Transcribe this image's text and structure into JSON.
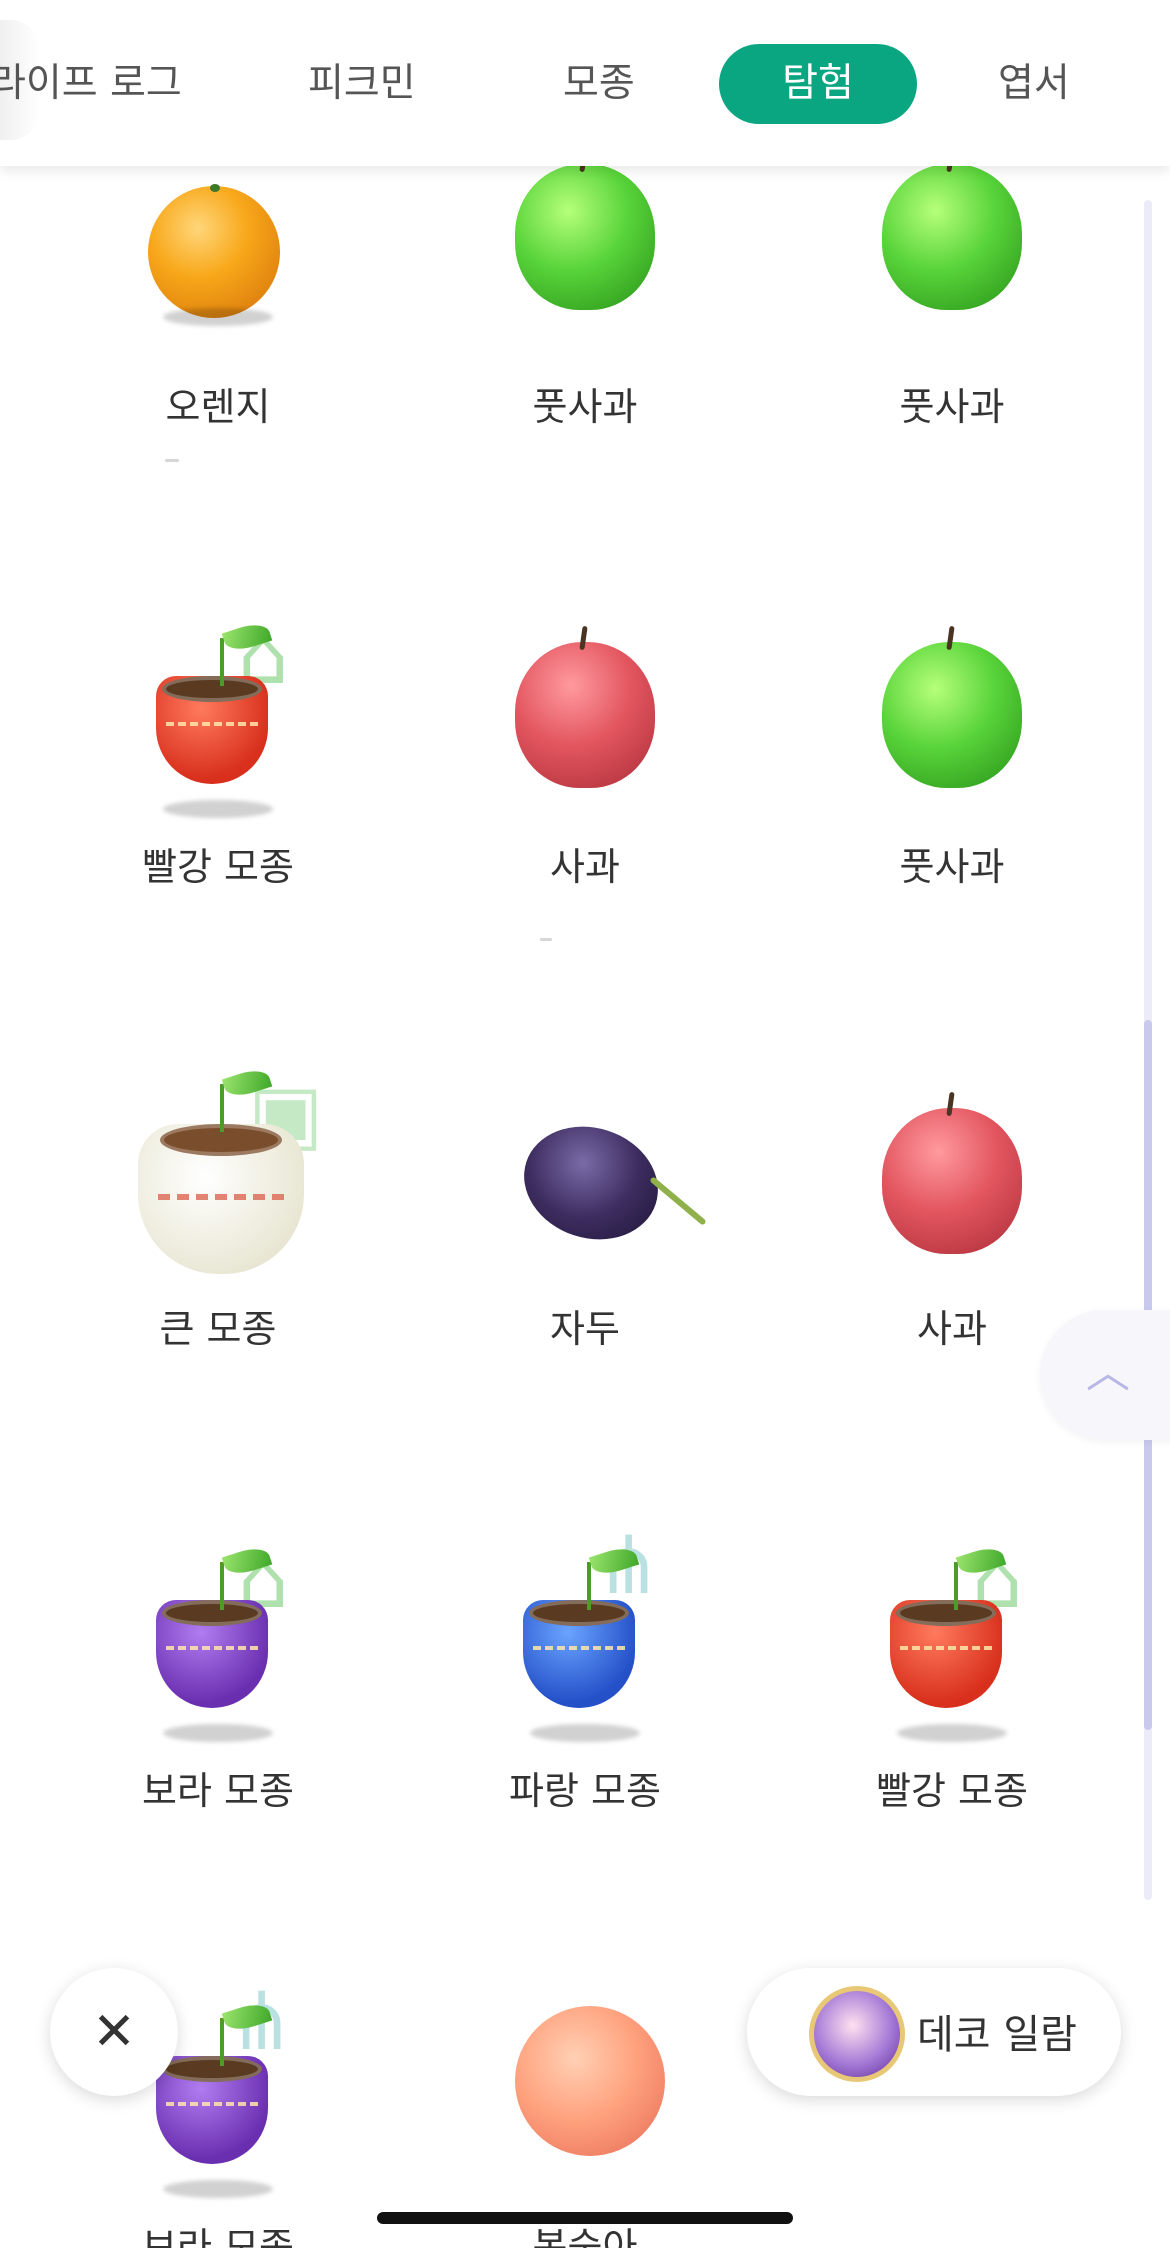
{
  "tabs": [
    {
      "label": "라이프 로그",
      "active": false
    },
    {
      "label": "피크민",
      "active": false
    },
    {
      "label": "모종",
      "active": false
    },
    {
      "label": "탐험",
      "active": true
    },
    {
      "label": "엽서",
      "active": false
    }
  ],
  "items": [
    {
      "label": "오렌지",
      "icon": "orange-icon"
    },
    {
      "label": "풋사과",
      "icon": "green-apple-icon"
    },
    {
      "label": "풋사과",
      "icon": "green-apple-icon"
    },
    {
      "label": "빨강 모종",
      "icon": "red-seedling-icon"
    },
    {
      "label": "사과",
      "icon": "apple-icon"
    },
    {
      "label": "풋사과",
      "icon": "green-apple-icon"
    },
    {
      "label": "큰 모종",
      "icon": "big-seedling-icon"
    },
    {
      "label": "자두",
      "icon": "plum-icon"
    },
    {
      "label": "사과",
      "icon": "apple-icon"
    },
    {
      "label": "보라 모종",
      "icon": "purple-seedling-icon"
    },
    {
      "label": "파랑 모종",
      "icon": "blue-seedling-icon"
    },
    {
      "label": "빨강 모종",
      "icon": "red-seedling-icon"
    },
    {
      "label": "보라 모종",
      "icon": "purple-seedling-icon"
    },
    {
      "label": "복숭아",
      "icon": "peach-icon"
    }
  ],
  "close_button": {
    "label": "✕"
  },
  "deco_button": {
    "label": "데코 일람"
  },
  "colors": {
    "accent": "#0aa682",
    "scrollbar": "#c9c9ee"
  }
}
